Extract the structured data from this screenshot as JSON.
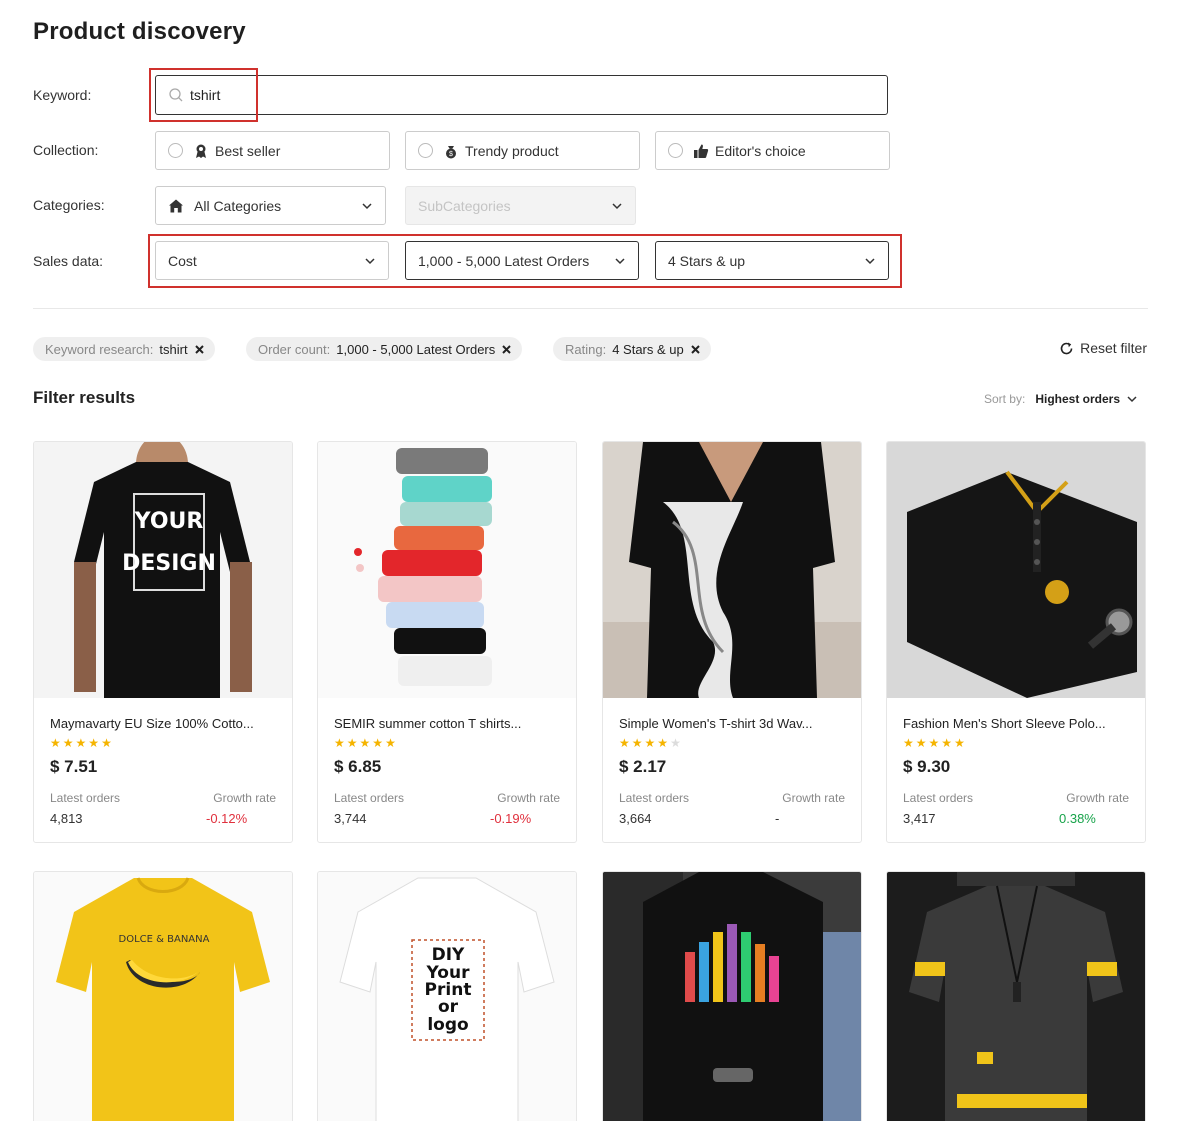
{
  "page": {
    "title": "Product discovery"
  },
  "filters": {
    "keyword_label": "Keyword:",
    "keyword_value": "tshirt",
    "collection_label": "Collection:",
    "collections": [
      {
        "label": "Best seller",
        "icon": "award-icon"
      },
      {
        "label": "Trendy product",
        "icon": "bag-icon"
      },
      {
        "label": "Editor's choice",
        "icon": "thumbs-up-icon"
      }
    ],
    "categories_label": "Categories:",
    "category_value": "All Categories",
    "subcategory_placeholder": "SubCategories",
    "sales_label": "Sales data:",
    "cost_value": "Cost",
    "orders_value": "1,000 - 5,000 Latest Orders",
    "rating_value": "4 Stars & up"
  },
  "active_filters": [
    {
      "key": "Keyword research:",
      "value": "tshirt"
    },
    {
      "key": "Order count:",
      "value": "1,000 - 5,000 Latest Orders"
    },
    {
      "key": "Rating:",
      "value": "4 Stars & up"
    }
  ],
  "reset_label": "Reset filter",
  "results": {
    "title": "Filter results",
    "sort_label": "Sort by:",
    "sort_value": "Highest orders",
    "orders_label": "Latest orders",
    "growth_label": "Growth rate"
  },
  "products": [
    {
      "name": "Maymavarty EU Size 100% Cotto...",
      "rating": 5,
      "price": "$ 7.51",
      "orders": "4,813",
      "growth": "-0.12%"
    },
    {
      "name": "SEMIR summer cotton T shirts...",
      "rating": 5,
      "price": "$ 6.85",
      "orders": "3,744",
      "growth": "-0.19%"
    },
    {
      "name": "Simple Women's T-shirt 3d Wav...",
      "rating": 4,
      "price": "$ 2.17",
      "orders": "3,664",
      "growth": "-"
    },
    {
      "name": "Fashion Men's Short Sleeve Polo...",
      "rating": 5,
      "price": "$ 9.30",
      "orders": "3,417",
      "growth": "0.38%"
    }
  ],
  "image_text": {
    "p1": [
      "YOUR",
      "DESIGN"
    ],
    "p5": "DOLCE & BANANA",
    "p6": [
      "DIY",
      "Your",
      "Print",
      "or",
      "logo"
    ]
  },
  "colors": {
    "accent_red": "#d0312d",
    "star": "#f5b400",
    "negative": "#e0303d",
    "positive": "#17a34a"
  }
}
